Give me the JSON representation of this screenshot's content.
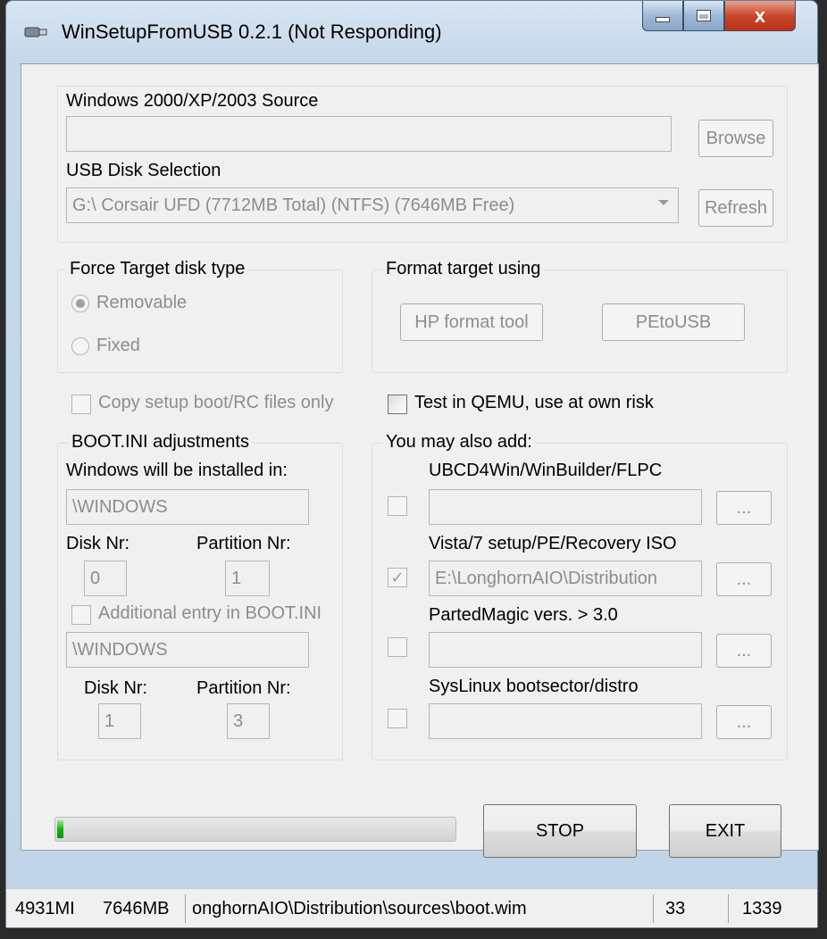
{
  "window": {
    "title": "WinSetupFromUSB 0.2.1 (Not Responding)",
    "close_glyph": "x"
  },
  "source": {
    "label": "Windows 2000/XP/2003 Source",
    "value": "",
    "browse_label": "Browse"
  },
  "usb": {
    "label": "USB Disk Selection",
    "selected": "G:\\ Corsair UFD (7712MB Total) (NTFS) (7646MB Free)",
    "refresh_label": "Refresh"
  },
  "force_target": {
    "title": "Force Target disk type",
    "removable_label": "Removable",
    "fixed_label": "Fixed",
    "selected": "Removable"
  },
  "format_target": {
    "title": "Format target using",
    "hp_label": "HP format tool",
    "petousb_label": "PEtoUSB"
  },
  "copy_setup": {
    "label": "Copy setup boot/RC files only",
    "checked": false
  },
  "test_qemu": {
    "label": "Test in QEMU, use at own risk",
    "checked": false
  },
  "bootini": {
    "title": "BOOT.INI adjustments",
    "installed_in_label": "Windows will be installed in:",
    "installed_in_value": "\\WINDOWS",
    "disk_nr_label": "Disk Nr:",
    "partition_nr_label": "Partition Nr:",
    "disk_nr_value": "0",
    "partition_nr_value": "1",
    "additional_label": "Additional entry in BOOT.INI",
    "additional_checked": false,
    "additional_value": "\\WINDOWS",
    "disk_nr2_label": "Disk Nr:",
    "partition_nr2_label": "Partition Nr:",
    "disk_nr2_value": "1",
    "partition_nr2_value": "3"
  },
  "addons": {
    "title": "You may also add:",
    "browse_glyph": "...",
    "items": [
      {
        "label": "UBCD4Win/WinBuilder/FLPC",
        "value": "",
        "checked": false
      },
      {
        "label": "Vista/7 setup/PE/Recovery ISO",
        "value": "E:\\LonghornAIO\\Distribution",
        "checked": true
      },
      {
        "label": "PartedMagic vers. > 3.0",
        "value": "",
        "checked": false
      },
      {
        "label": "SysLinux bootsector/distro",
        "value": "",
        "checked": false
      }
    ]
  },
  "progress": {
    "percent": 2,
    "color": "#16b116"
  },
  "buttons": {
    "stop_label": "STOP",
    "exit_label": "EXIT"
  },
  "statusbar": {
    "p1": "4931MI",
    "p2": "7646MB",
    "p3": "onghornAIO\\Distribution\\sources\\boot.wim",
    "p4": "33",
    "p5": "1339"
  }
}
